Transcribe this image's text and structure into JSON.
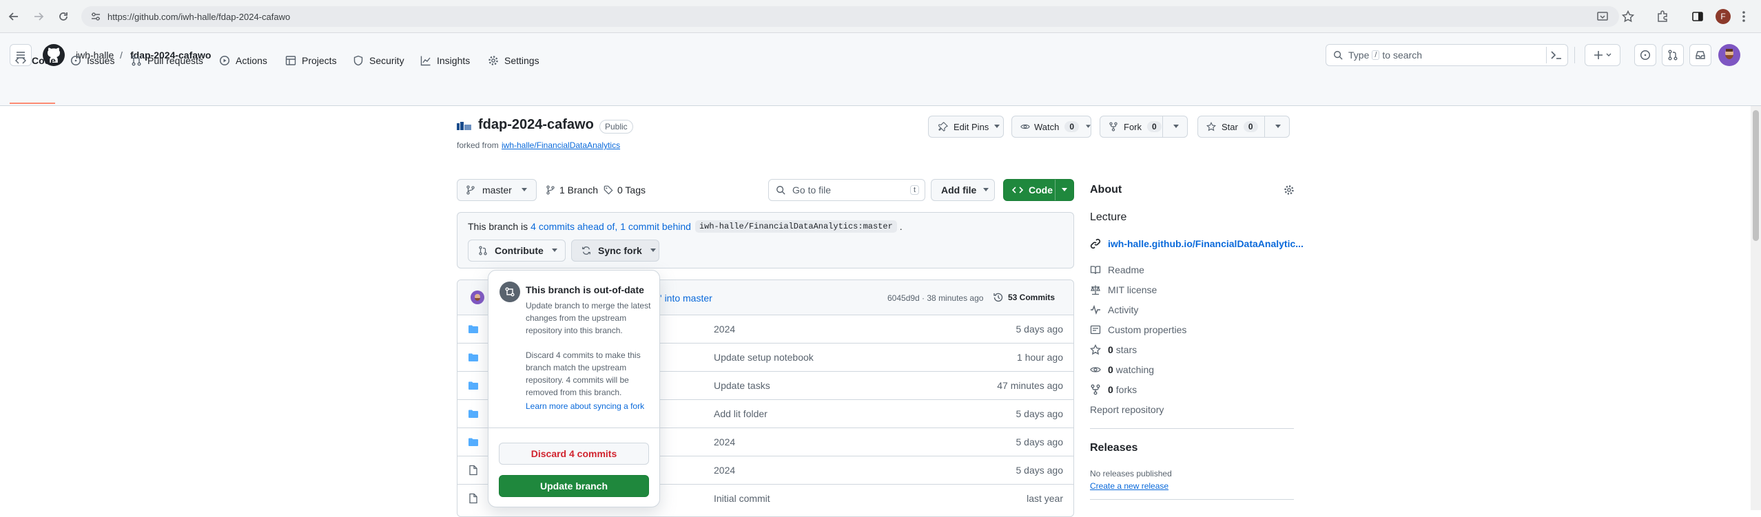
{
  "browser": {
    "url": "https://github.com/iwh-halle/fdap-2024-cafawo",
    "profile_initial": "F"
  },
  "header": {
    "owner": "iwh-halle",
    "separator": "/",
    "repo": "fdap-2024-cafawo",
    "search_prefix": "Type",
    "search_key": "/",
    "search_suffix": "to search"
  },
  "tabs": [
    {
      "label": "Code"
    },
    {
      "label": "Issues"
    },
    {
      "label": "Pull requests"
    },
    {
      "label": "Actions"
    },
    {
      "label": "Projects"
    },
    {
      "label": "Security"
    },
    {
      "label": "Insights"
    },
    {
      "label": "Settings"
    }
  ],
  "repo": {
    "name": "fdap-2024-cafawo",
    "visibility": "Public",
    "forked_from_prefix": "forked from",
    "forked_from": "iwh-halle/FinancialDataAnalytics",
    "edit_pins": "Edit Pins",
    "watch": "Watch",
    "watch_count": "0",
    "fork": "Fork",
    "fork_count": "0",
    "star": "Star",
    "star_count": "0"
  },
  "toolbar": {
    "branch": "master",
    "branches": "1 Branch",
    "tags": "0 Tags",
    "goto_placeholder": "Go to file",
    "goto_key": "t",
    "add_file": "Add file",
    "code": "Code"
  },
  "status": {
    "prefix": "This branch is",
    "ahead": "4 commits ahead of,",
    "behind": "1 commit behind",
    "upstream": "iwh-halle/FinancialDataAnalytics:master",
    "suffix": ".",
    "contribute": "Contribute",
    "sync_fork": "Sync fork"
  },
  "commit": {
    "message_tail": "' into master",
    "sha_time": "6045d9d · 38 minutes ago",
    "commits": "53 Commits"
  },
  "files": [
    {
      "message": "2024",
      "time": "5 days ago",
      "type": "folder"
    },
    {
      "message": "Update setup notebook",
      "time": "1 hour ago",
      "type": "folder"
    },
    {
      "message": "Update tasks",
      "time": "47 minutes ago",
      "type": "folder"
    },
    {
      "message": "Add lit folder",
      "time": "5 days ago",
      "type": "folder"
    },
    {
      "message": "2024",
      "time": "5 days ago",
      "type": "folder"
    },
    {
      "message": "2024",
      "time": "5 days ago",
      "type": "file"
    },
    {
      "message": "Initial commit",
      "time": "last year",
      "type": "file"
    }
  ],
  "popover": {
    "title": "This branch is out-of-date",
    "p1": "Update branch to merge the latest changes from the upstream repository into this branch.",
    "p2": "Discard 4 commits to make this branch match the upstream repository. 4 commits will be removed from this branch.",
    "learn_more": "Learn more about syncing a fork",
    "discard": "Discard 4 commits",
    "update": "Update branch"
  },
  "about": {
    "heading": "About",
    "description": "Lecture",
    "website": "iwh-halle.github.io/FinancialDataAnalytic...",
    "items": [
      "Readme",
      "MIT license",
      "Activity",
      "Custom properties"
    ],
    "stars_count": "0",
    "stars_label": "stars",
    "watching_count": "0",
    "watching_label": "watching",
    "forks_count": "0",
    "forks_label": "forks",
    "report": "Report repository"
  },
  "releases": {
    "heading": "Releases",
    "none": "No releases published",
    "create": "Create a new release"
  }
}
